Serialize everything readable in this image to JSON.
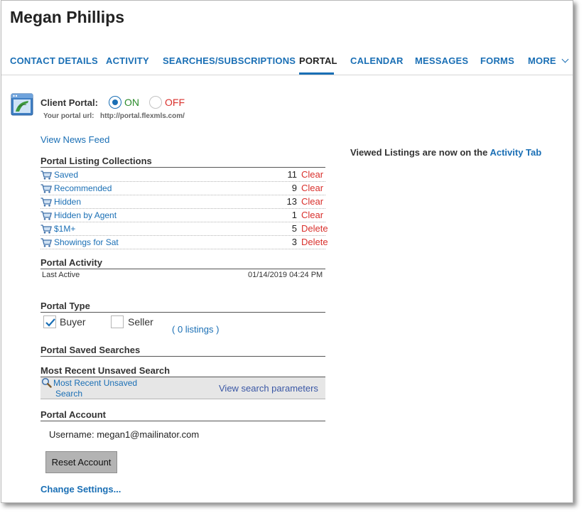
{
  "contact": {
    "name": "Megan Phillips"
  },
  "tabs": [
    {
      "label": "CONTACT DETAILS"
    },
    {
      "label": "ACTIVITY"
    },
    {
      "label": "SEARCHES/SUBSCRIPTIONS"
    },
    {
      "label": "PORTAL",
      "active": true
    },
    {
      "label": "CALENDAR"
    },
    {
      "label": "MESSAGES"
    },
    {
      "label": "FORMS"
    },
    {
      "label": "MORE"
    }
  ],
  "portal": {
    "client_portal_label": "Client Portal:",
    "on_label": "ON",
    "off_label": "OFF",
    "selected": "ON",
    "url_label": "Your portal url:",
    "url_value": "http://portal.flexmls.com/",
    "news_feed_link": "View News Feed"
  },
  "collections": {
    "title": "Portal Listing Collections",
    "items": [
      {
        "name": "Saved",
        "count": "11",
        "action": "Clear"
      },
      {
        "name": "Recommended",
        "count": "9",
        "action": "Clear"
      },
      {
        "name": "Hidden",
        "count": "13",
        "action": "Clear"
      },
      {
        "name": "Hidden by Agent",
        "count": "1",
        "action": "Clear"
      },
      {
        "name": "$1M+",
        "count": "5",
        "action": "Delete"
      },
      {
        "name": "Showings for Sat",
        "count": "3",
        "action": "Delete"
      }
    ]
  },
  "viewed_note": {
    "text": "Viewed Listings are now on the ",
    "link": "Activity Tab"
  },
  "activity": {
    "title": "Portal Activity",
    "last_active_label": "Last Active",
    "last_active_value": "01/14/2019 04:24 PM"
  },
  "portal_type": {
    "title": "Portal Type",
    "buyer_label": "Buyer",
    "buyer_checked": true,
    "seller_label": "Seller",
    "seller_checked": false,
    "listings_link": "( 0 listings )"
  },
  "saved_searches": {
    "title": "Portal Saved Searches"
  },
  "unsaved_search": {
    "title": "Most Recent Unsaved Search",
    "link_line1": "Most Recent Unsaved",
    "link_line2": "Search",
    "params_link": "View search parameters"
  },
  "account": {
    "title": "Portal Account",
    "username_text": "Username: megan1@mailinator.com",
    "reset_button": "Reset Account",
    "change_settings_link": "Change Settings..."
  },
  "colors": {
    "link": "#1a6fb5",
    "on": "#2a8a2a",
    "danger": "#d9302c",
    "search_box_bg": "#e6e6e6",
    "button_bg": "#b3b3b3"
  }
}
